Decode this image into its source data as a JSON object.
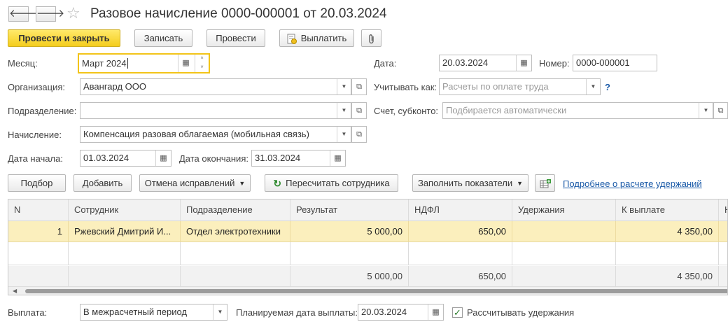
{
  "window": {
    "back_glyph": "🡐",
    "forward_glyph": "🡒",
    "star_glyph": "☆",
    "title": "Разовое начисление 0000-000001 от 20.03.2024"
  },
  "toolbar": {
    "post_close": "Провести и закрыть",
    "save": "Записать",
    "post": "Провести",
    "pay": "Выплатить",
    "attach_icon": "paperclip-icon"
  },
  "form": {
    "month_label": "Месяц:",
    "month_value": "Март 2024",
    "date_label": "Дата:",
    "date_value": "20.03.2024",
    "number_label": "Номер:",
    "number_value": "0000-000001",
    "org_label": "Организация:",
    "org_value": "Авангард ООО",
    "account_as_label": "Учитывать как:",
    "account_as_placeholder": "Расчеты по оплате труда",
    "help_glyph": "?",
    "dept_label": "Подразделение:",
    "dept_value": "",
    "subconto_label": "Счет, субконто:",
    "subconto_placeholder": "Подбирается автоматически",
    "accrual_label": "Начисление:",
    "accrual_value": "Компенсация разовая облагаемая (мобильная связь)",
    "start_label": "Дата начала:",
    "start_value": "01.03.2024",
    "end_label": "Дата окончания:",
    "end_value": "31.03.2024"
  },
  "table_toolbar": {
    "pick": "Подбор",
    "add": "Добавить",
    "cancel_fix": "Отмена исправлений",
    "recalc": "Пересчитать сотрудника",
    "fill": "Заполнить показатели",
    "details_link": "Подробнее о расчете удержаний"
  },
  "table": {
    "headers": [
      "N",
      "Сотрудник",
      "Подразделение",
      "Результат",
      "НДФЛ",
      "Удержания",
      "К выплате",
      "Н"
    ],
    "rows": [
      [
        "1",
        "Ржевский Дмитрий И...",
        "Отдел электротехники",
        "5 000,00",
        "650,00",
        "",
        "4 350,00"
      ]
    ],
    "totals": [
      "",
      "",
      "",
      "5 000,00",
      "650,00",
      "",
      "4 350,00"
    ]
  },
  "footer": {
    "payment_label": "Выплата:",
    "payment_value": "В межрасчетный период",
    "planned_label": "Планируемая дата выплаты:",
    "planned_value": "20.03.2024",
    "calc_deductions_label": "Рассчитывать удержания",
    "calc_deductions_checked": true,
    "check_glyph": "✓"
  },
  "colors": {
    "primary_button": "#f4cd1d",
    "selected_row": "#fbefbd",
    "link": "#1a5aa8",
    "focus_border": "#f2c419"
  }
}
